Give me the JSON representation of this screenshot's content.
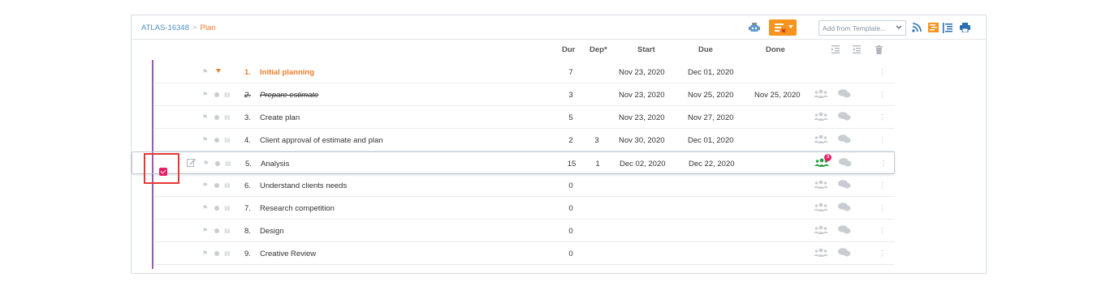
{
  "breadcrumb": {
    "project": "ATLAS-16348",
    "separator": ">",
    "page": "Plan"
  },
  "toolbar": {
    "template_placeholder": "Add from Template...",
    "icons": [
      "robot-icon",
      "filter-icon",
      "rss-icon",
      "gantt-icon",
      "indent-icon",
      "print-icon"
    ],
    "accent_color": "#f7941e"
  },
  "columns": {
    "dur": "Dur",
    "dep": "Dep*",
    "start": "Start",
    "due": "Due",
    "done": "Done"
  },
  "rows": [
    {
      "num": "1.",
      "name": "Initial planning",
      "dur": "7",
      "dep": "",
      "start": "Nov 23, 2020",
      "due": "Dec 01, 2020",
      "done": "",
      "type": "group"
    },
    {
      "num": "2.",
      "name": "Prepare estimate",
      "dur": "3",
      "dep": "",
      "start": "Nov 23, 2020",
      "due": "Nov 25, 2020",
      "done": "Nov 25, 2020",
      "type": "done"
    },
    {
      "num": "3.",
      "name": "Create plan",
      "dur": "5",
      "dep": "",
      "start": "Nov 23, 2020",
      "due": "Nov 27, 2020",
      "done": "",
      "type": "task"
    },
    {
      "num": "4.",
      "name": "Client approval of estimate and plan",
      "dur": "2",
      "dep": "3",
      "start": "Nov 30, 2020",
      "due": "Dec 01, 2020",
      "done": "",
      "type": "task"
    },
    {
      "num": "5.",
      "name": "Analysis",
      "dur": "15",
      "dep": "1",
      "start": "Dec 02, 2020",
      "due": "Dec 22, 2020",
      "done": "",
      "type": "selected",
      "badge": "3"
    },
    {
      "num": "6.",
      "name": "Understand clients needs",
      "dur": "0",
      "dep": "",
      "start": "",
      "due": "",
      "done": "",
      "type": "task"
    },
    {
      "num": "7.",
      "name": "Research competition",
      "dur": "0",
      "dep": "",
      "start": "",
      "due": "",
      "done": "",
      "type": "task"
    },
    {
      "num": "8.",
      "name": "Design",
      "dur": "0",
      "dep": "",
      "start": "",
      "due": "",
      "done": "",
      "type": "task"
    },
    {
      "num": "9.",
      "name": "Creative Review",
      "dur": "0",
      "dep": "",
      "start": "",
      "due": "",
      "done": "",
      "type": "task"
    }
  ],
  "colors": {
    "group_text": "#f07c2a",
    "tree_line": "#9b59b6",
    "checkbox": "#e91e63",
    "highlight_box": "#e53935",
    "assigned_group": "#2e9e44"
  }
}
